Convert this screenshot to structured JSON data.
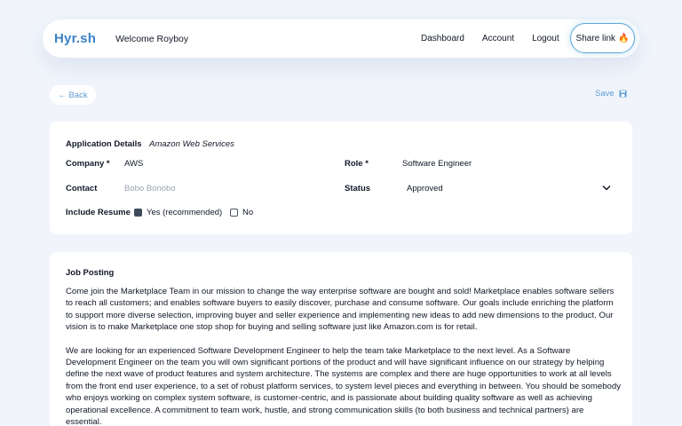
{
  "header": {
    "logo": "Hyr.sh",
    "welcome": "Welcome Royboy",
    "nav": [
      "Dashboard",
      "Account",
      "Logout"
    ],
    "share_label": "Share link"
  },
  "toolbar": {
    "back_label": "← Back",
    "save_label": "Save"
  },
  "application": {
    "section_label": "Application Details",
    "company_name": "Amazon Web Services",
    "company_label": "Company *",
    "company_value": "AWS",
    "role_label": "Role *",
    "role_value": "Software Engineer",
    "contact_label": "Contact",
    "contact_placeholder": "Bobo Bonobo",
    "status_label": "Status",
    "status_value": "Approved",
    "resume_label": "Include Resume",
    "resume_yes": "Yes (recommended)",
    "resume_no": "No"
  },
  "job": {
    "title": "Job Posting",
    "paragraphs": [
      "Come join the Marketplace Team in our mission to change the way enterprise software are bought and sold! Marketplace enables software sellers to reach all customers; and enables software buyers to easily discover, purchase and consume software. Our goals include enriching the platform to support more diverse selection, improving buyer and seller experience and implementing new ideas to add new dimensions to the product. Our vision is to make Marketplace one stop shop for buying and selling software just like Amazon.com is for retail.",
      "We are looking for an experienced Software Development Engineer to help the team take Marketplace to the next level. As a Software Development Engineer on the team you will own significant portions of the product and will have significant influence on our strategy by helping define the next wave of product features and system architecture. The systems are complex and there are huge opportunities to work at all levels from the front end user experience, to a set of robust platform services, to system level pieces and everything in between. You should be somebody who enjoys working on complex system software, is customer-centric, and is passionate about building quality software as well as achieving operational excellence. A commitment to team work, hustle, and strong communication skills (to both business and technical partners) are essential."
    ]
  },
  "colors": {
    "accent": "#5b9bd5",
    "brand": "#3b82c4"
  }
}
